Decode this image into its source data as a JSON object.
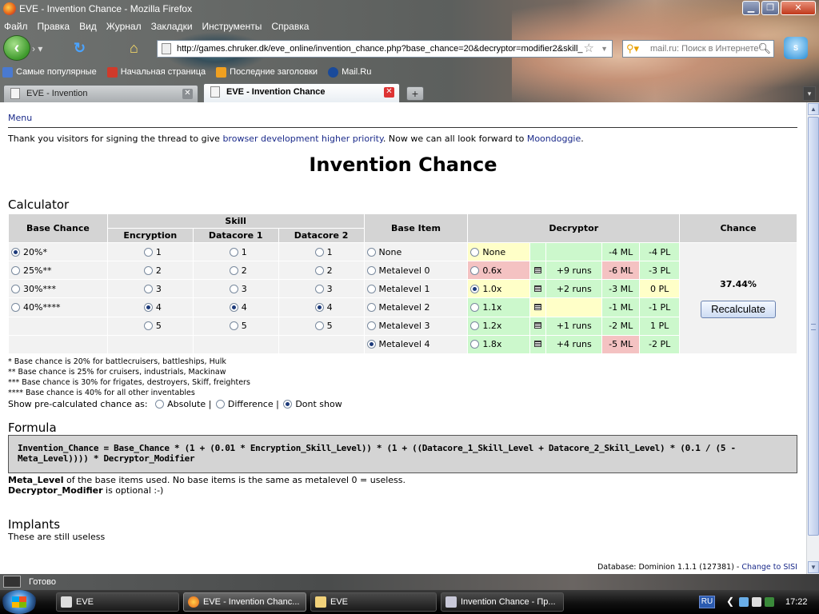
{
  "window": {
    "title": "EVE - Invention Chance - Mozilla Firefox"
  },
  "menubar": [
    "Файл",
    "Правка",
    "Вид",
    "Журнал",
    "Закладки",
    "Инструменты",
    "Справка"
  ],
  "url": "http://games.chruker.dk/eve_online/invention_chance.php?base_chance=20&decryptor=modifier2&skill_",
  "search_placeholder": "mail.ru: Поиск в Интернете",
  "bookmarks": [
    "Самые популярные",
    "Начальная страница",
    "Последние заголовки",
    "Mail.Ru"
  ],
  "tabs": [
    {
      "label": "EVE - Invention",
      "active": false
    },
    {
      "label": "EVE - Invention Chance",
      "active": true
    }
  ],
  "page": {
    "menu_link": "Menu",
    "thanks": {
      "before": "Thank you visitors for signing the thread to give ",
      "link1": "browser development higher priority",
      "middle": ". Now we can all look forward to ",
      "link2": "Moondoggie",
      "after": "."
    },
    "title": "Invention Chance",
    "calculator_heading": "Calculator",
    "headers": {
      "base_chance": "Base Chance",
      "skill": "Skill",
      "encryption": "Encryption",
      "datacore1": "Datacore 1",
      "datacore2": "Datacore 2",
      "base_item": "Base Item",
      "decryptor": "Decryptor",
      "chance": "Chance"
    },
    "base_chance": [
      {
        "label": "20%*",
        "checked": true
      },
      {
        "label": "25%**",
        "checked": false
      },
      {
        "label": "30%***",
        "checked": false
      },
      {
        "label": "40%****",
        "checked": false
      }
    ],
    "skill_levels": [
      "1",
      "2",
      "3",
      "4",
      "5"
    ],
    "skill_selected": "4",
    "base_items": [
      {
        "label": "None",
        "checked": false
      },
      {
        "label": "Metalevel 0",
        "checked": false
      },
      {
        "label": "Metalevel 1",
        "checked": false
      },
      {
        "label": "Metalevel 2",
        "checked": false
      },
      {
        "label": "Metalevel 3",
        "checked": false
      },
      {
        "label": "Metalevel 4",
        "checked": true
      }
    ],
    "decryptors": [
      {
        "mult": "None",
        "runs": "",
        "ml": "-4 ML",
        "pl": "-4 PL",
        "checked": false,
        "icon": false,
        "c_mult": "y",
        "c_runs": "g",
        "c_ml": "g",
        "c_pl": "g"
      },
      {
        "mult": "0.6x",
        "runs": "+9 runs",
        "ml": "-6 ML",
        "pl": "-3 PL",
        "checked": false,
        "icon": true,
        "c_mult": "r",
        "c_runs": "g",
        "c_ml": "r",
        "c_pl": "g"
      },
      {
        "mult": "1.0x",
        "runs": "+2 runs",
        "ml": "-3 ML",
        "pl": "0 PL",
        "checked": true,
        "icon": true,
        "c_mult": "y",
        "c_runs": "g",
        "c_ml": "g",
        "c_pl": "y"
      },
      {
        "mult": "1.1x",
        "runs": "",
        "ml": "-1 ML",
        "pl": "-1 PL",
        "checked": false,
        "icon": true,
        "c_mult": "g",
        "c_runs": "y",
        "c_ml": "g",
        "c_pl": "g"
      },
      {
        "mult": "1.2x",
        "runs": "+1 runs",
        "ml": "-2 ML",
        "pl": "1 PL",
        "checked": false,
        "icon": true,
        "c_mult": "g",
        "c_runs": "g",
        "c_ml": "g",
        "c_pl": "g"
      },
      {
        "mult": "1.8x",
        "runs": "+4 runs",
        "ml": "-5 ML",
        "pl": "-2 PL",
        "checked": false,
        "icon": true,
        "c_mult": "g",
        "c_runs": "g",
        "c_ml": "r",
        "c_pl": "g"
      }
    ],
    "chance_value": "37.44%",
    "recalculate": "Recalculate",
    "notes": [
      "* Base chance is 20% for battlecruisers, battleships, Hulk",
      "** Base chance is 25% for cruisers, industrials, Mackinaw",
      "*** Base chance is 30% for frigates, destroyers, Skiff, freighters",
      "**** Base chance is 40% for all other inventables"
    ],
    "show_label": "Show pre-calculated chance as:",
    "show_options": [
      {
        "label": "Absolute",
        "checked": false
      },
      {
        "label": "Difference",
        "checked": false
      },
      {
        "label": "Dont show",
        "checked": true
      }
    ],
    "formula_heading": "Formula",
    "formula": "Invention_Chance = Base_Chance * (1 + (0.01 * Encryption_Skill_Level)) * (1 + ((Datacore_1_Skill_Level + Datacore_2_Skill_Level) * (0.1 / (5 - Meta_Level)))) * Decryptor_Modifier",
    "meta_term": "Meta_Level",
    "meta_text": " of the base items used. No base items is the same as metalevel 0 = useless.",
    "decryptor_term": "Decryptor_Modifier",
    "decryptor_text": " is optional :-)",
    "implants_heading": "Implants",
    "implants_text": "These are still useless",
    "db_text": "Database: Dominion 1.1.1 (127381) - ",
    "db_link": "Change to SISI"
  },
  "status": "Готово",
  "taskbar": {
    "items": [
      "EVE",
      "EVE - Invention Chanc...",
      "EVE",
      "Invention Chance - Пр..."
    ],
    "lang": "RU",
    "clock": "17:22"
  },
  "colors": {
    "green": "#ccf8cc",
    "yellow": "#ffffc8",
    "red": "#f4c2c2",
    "header": "#d4d4d4",
    "link": "#1a2a8a"
  }
}
